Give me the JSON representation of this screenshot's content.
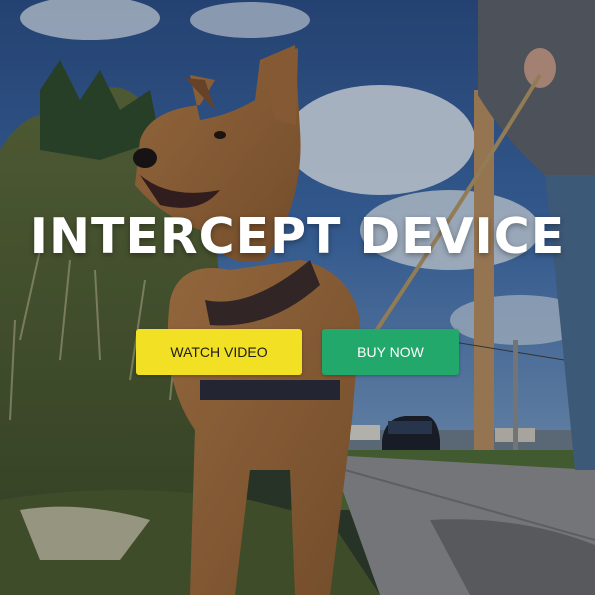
{
  "hero": {
    "headline": "INTERCEPT DEVICE",
    "watch_video_label": "WATCH VIDEO",
    "buy_now_label": "BUY NOW"
  },
  "colors": {
    "watch_button": "#f2e024",
    "buy_button": "#22a86a",
    "headline_text": "#ffffff"
  },
  "background_scene_icons": [
    "dog-photo",
    "walker-legs",
    "leash",
    "utility-pole",
    "parked-car",
    "sidewalk"
  ]
}
